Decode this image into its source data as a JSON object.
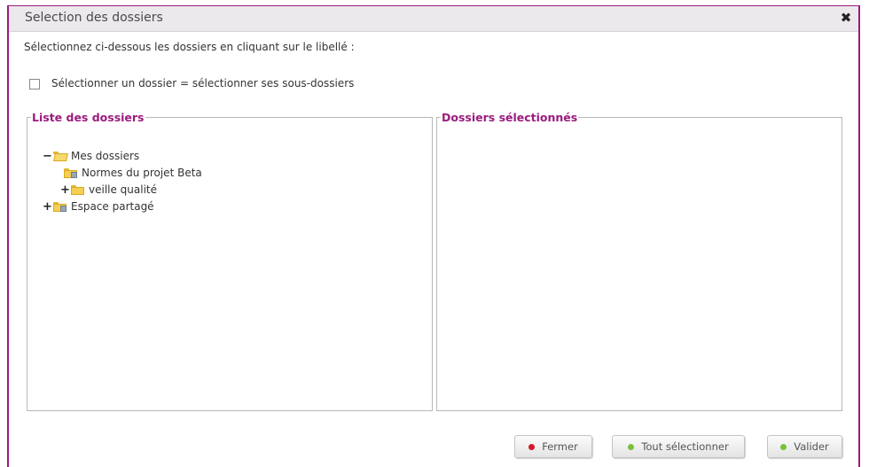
{
  "dialog": {
    "title": "Selection des dossiers",
    "close_icon": "close-icon",
    "instruction": "Sélectionnez ci-dessous les dossiers en cliquant sur le libellé :",
    "subfolder_option": {
      "label": "Sélectionner un dossier = sélectionner ses sous-dossiers",
      "checked": false
    }
  },
  "left_panel": {
    "legend": "Liste des dossiers",
    "tree": [
      {
        "label": "Mes dossiers",
        "toggle": "−",
        "icon": "folder-open-icon"
      },
      {
        "label": "Normes du projet Beta",
        "toggle": "",
        "icon": "shared-folder-icon"
      },
      {
        "label": "veille qualité",
        "toggle": "+",
        "icon": "folder-icon"
      },
      {
        "label": "Espace partagé",
        "toggle": "+",
        "icon": "shared-folder-icon"
      }
    ]
  },
  "right_panel": {
    "legend": "Dossiers sélectionnés",
    "items": []
  },
  "buttons": {
    "close": "Fermer",
    "select_all": "Tout sélectionner",
    "validate": "Valider"
  },
  "colors": {
    "accent": "#9b1b7e",
    "close_dot": "#d8162a",
    "ok_dot": "#79c13a"
  }
}
